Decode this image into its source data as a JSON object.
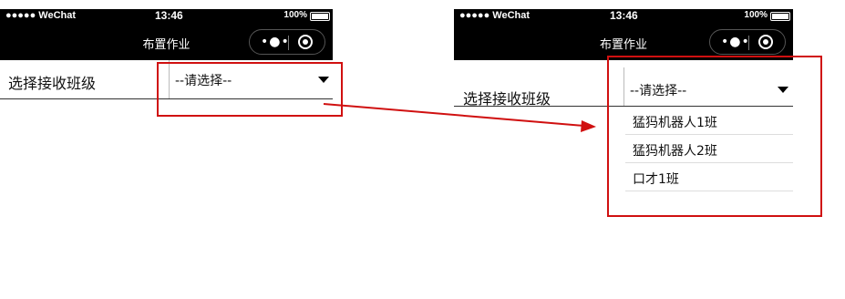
{
  "status_bar": {
    "carrier": "●●●●● WeChat",
    "wifi_icon": "wifi-icon",
    "time": "13:46",
    "battery_text": "100%"
  },
  "nav": {
    "title": "布置作业",
    "more_icon": "•●•",
    "target_icon": "target-icon"
  },
  "form": {
    "label": "选择接收班级",
    "picker_value": "--请选择--"
  },
  "dropdown": {
    "options": [
      "猛犸机器人1班",
      "猛犸机器人2班",
      "口才1班"
    ]
  },
  "colors": {
    "accent_red": "#d01010",
    "bar_black": "#000000"
  }
}
